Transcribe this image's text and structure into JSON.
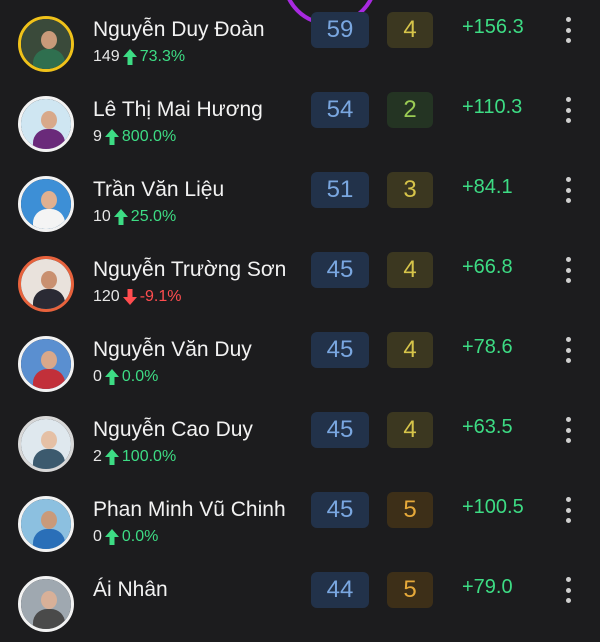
{
  "leaderboard": {
    "rows": [
      {
        "name": "Nguyễn Duy Đoàn",
        "count": "149",
        "trend": "up",
        "pct": "73.3%",
        "score": "59",
        "rank": "4",
        "rank_style": "yellow",
        "delta": "+156.3",
        "ring": "#f0c21a",
        "sky": "#3a4a3a",
        "shirt": "#2f6f4f",
        "skin": "#c99a7a"
      },
      {
        "name": "Lê Thị Mai Hương",
        "count": "9",
        "trend": "up",
        "pct": "800.0%",
        "score": "54",
        "rank": "2",
        "rank_style": "green",
        "delta": "+110.3",
        "ring": "#f2f2f2",
        "sky": "#cfe6f2",
        "shirt": "#6a2a7a",
        "skin": "#d8a98a"
      },
      {
        "name": "Trần Văn Liệu",
        "count": "10",
        "trend": "up",
        "pct": "25.0%",
        "score": "51",
        "rank": "3",
        "rank_style": "yellow",
        "delta": "+84.1",
        "ring": "#f2f2f2",
        "sky": "#3d8fd6",
        "shirt": "#f4f4f4",
        "skin": "#e0b090"
      },
      {
        "name": "Nguyễn Trường Sơn",
        "count": "120",
        "trend": "down",
        "pct": "-9.1%",
        "score": "45",
        "rank": "4",
        "rank_style": "yellow",
        "delta": "+66.8",
        "ring": "#e8623c",
        "sky": "#e9e2dc",
        "shirt": "#2a2a34",
        "skin": "#c99070"
      },
      {
        "name": "Nguyễn Văn Duy",
        "count": "0",
        "trend": "up",
        "pct": "0.0%",
        "score": "45",
        "rank": "4",
        "rank_style": "yellow",
        "delta": "+78.6",
        "ring": "#f2f2f2",
        "sky": "#5a8fd0",
        "shirt": "#c2303a",
        "skin": "#d9a88a"
      },
      {
        "name": "Nguyễn Cao Duy",
        "count": "2",
        "trend": "up",
        "pct": "100.0%",
        "score": "45",
        "rank": "4",
        "rank_style": "yellow",
        "delta": "+63.5",
        "ring": "#d8d8d8",
        "sky": "#dfe8ee",
        "shirt": "#3c5a6e",
        "skin": "#e5c0a5"
      },
      {
        "name": "Phan Minh Vũ Chinh",
        "count": "0",
        "trend": "up",
        "pct": "0.0%",
        "score": "45",
        "rank": "5",
        "rank_style": "orange",
        "delta": "+100.5",
        "ring": "#f2f2f2",
        "sky": "#8cc0e0",
        "shirt": "#2a6fb8",
        "skin": "#c99a7a"
      },
      {
        "name": "Ái Nhân",
        "count": "",
        "trend": "",
        "pct": "",
        "score": "44",
        "rank": "5",
        "rank_style": "orange",
        "delta": "+79.0",
        "ring": "#f2f2f2",
        "sky": "#9fa8b0",
        "shirt": "#4a4a4a",
        "skin": "#d8b098"
      }
    ]
  },
  "colors": {
    "up": "#3ddc84",
    "down": "#ff4d4f",
    "background": "#1c1c1e",
    "accent_arc": "#a829e0"
  }
}
